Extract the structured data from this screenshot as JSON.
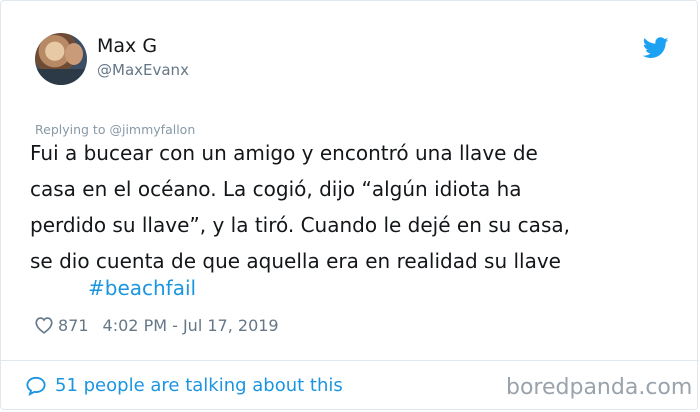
{
  "user": {
    "name": "Max G",
    "handle": "@MaxEvanx"
  },
  "reply": {
    "prefix": "Replying to",
    "to": "@jimmyfallon"
  },
  "tweet": {
    "lines": [
      "Fui a bucear con un amigo y encontró una llave de",
      "casa en el océano. La cogió, dijo “algún idiota ha",
      "perdido su llave”, y la tiró. Cuando le dejé en su casa,",
      "se dio cuenta de que aquella era en realidad su llave"
    ],
    "hashtag": "#beachfail"
  },
  "meta": {
    "likes": "871",
    "timestamp": "4:02 PM - Jul 17, 2019"
  },
  "footer": {
    "talking": "51 people are talking about this",
    "watermark": "boredpanda.com"
  },
  "icons": {
    "brand": "twitter-bird-icon",
    "like": "heart-icon",
    "reply": "speech-bubble-icon"
  },
  "colors": {
    "link": "#1b95e0",
    "muted": "#657786",
    "text": "#14171a"
  }
}
